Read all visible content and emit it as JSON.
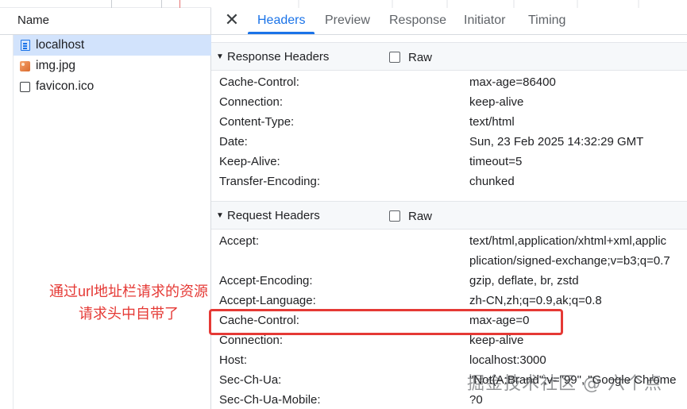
{
  "network": {
    "column_header": "Name",
    "requests": [
      {
        "name": "localhost",
        "icon": "document-icon",
        "selected": true
      },
      {
        "name": "img.jpg",
        "icon": "image-icon",
        "selected": false
      },
      {
        "name": "favicon.ico",
        "icon": "checkbox-icon",
        "selected": false
      }
    ]
  },
  "tabs": [
    "Headers",
    "Preview",
    "Response",
    "Initiator",
    "Timing"
  ],
  "active_tab": "Headers",
  "response_headers": {
    "title": "Response Headers",
    "raw_label": "Raw",
    "rows": [
      {
        "k": "Cache-Control:",
        "v": "max-age=86400"
      },
      {
        "k": "Connection:",
        "v": "keep-alive"
      },
      {
        "k": "Content-Type:",
        "v": "text/html"
      },
      {
        "k": "Date:",
        "v": "Sun, 23 Feb 2025 14:32:29 GMT"
      },
      {
        "k": "Keep-Alive:",
        "v": "timeout=5"
      },
      {
        "k": "Transfer-Encoding:",
        "v": "chunked"
      }
    ]
  },
  "request_headers": {
    "title": "Request Headers",
    "raw_label": "Raw",
    "accept_key": "Accept:",
    "accept_line1": "text/html,application/xhtml+xml,applic",
    "accept_line2": "plication/signed-exchange;v=b3;q=0.7",
    "rows": [
      {
        "k": "Accept-Encoding:",
        "v": "gzip, deflate, br, zstd"
      },
      {
        "k": "Accept-Language:",
        "v": "zh-CN,zh;q=0.9,ak;q=0.8"
      },
      {
        "k": "Cache-Control:",
        "v": "max-age=0"
      },
      {
        "k": "Connection:",
        "v": "keep-alive"
      },
      {
        "k": "Host:",
        "v": "localhost:3000"
      },
      {
        "k": "Sec-Ch-Ua:",
        "v": "\"Not(A:Brand\";v=\"99\", \"Google Chrome"
      },
      {
        "k": "Sec-Ch-Ua-Mobile:",
        "v": "?0"
      }
    ]
  },
  "annotation": {
    "line1": "通过url地址栏请求的资源",
    "line2": "请求头中自带了"
  },
  "watermark": "掘金技术社区 @ 六个点",
  "colors": {
    "accent": "#1a73e8",
    "annotation": "#e53935",
    "selected_row": "#d2e3fc"
  }
}
